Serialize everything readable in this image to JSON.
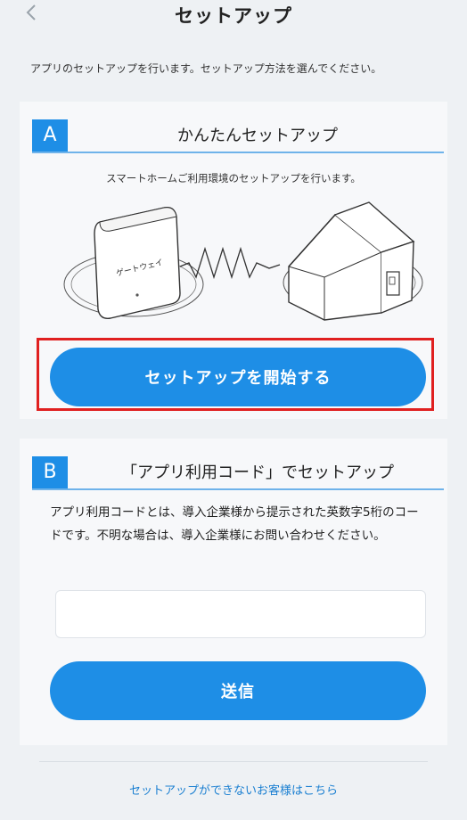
{
  "header": {
    "back_icon": "chevron-left-icon",
    "title": "セットアップ"
  },
  "intro_text": "アプリのセットアップを行います。セットアップ方法を選んでください。",
  "section_a": {
    "letter": "A",
    "title": "かんたんセットアップ",
    "description": "スマートホームご利用環境のセットアップを行います。",
    "gateway_label": "ゲートウェイ",
    "start_button": "セットアップを開始する"
  },
  "section_b": {
    "letter": "B",
    "title": "「アプリ利用コード」でセットアップ",
    "description": "アプリ利用コードとは、導入企業様から提示された英数字5桁のコードです。不明な場合は、導入企業様にお問い合わせください。",
    "code_input": {
      "value": "",
      "placeholder": ""
    },
    "submit_button": "送信"
  },
  "footer_link": "セットアップができないお客様はこちら",
  "colors": {
    "accent": "#1e8ee6",
    "background": "#eef1f4",
    "card": "#f7f8fa",
    "highlight_border": "#e02020",
    "link": "#1a7fd1"
  }
}
